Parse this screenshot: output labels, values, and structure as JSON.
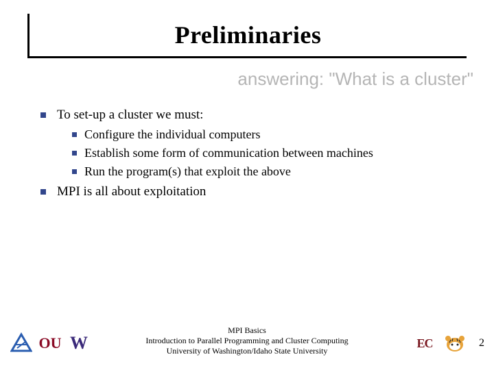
{
  "title": "Preliminaries",
  "subtitle": "answering: \"What is a cluster\"",
  "bullets": {
    "item0": "To set-up a cluster we must:",
    "sub0": "Configure the individual computers",
    "sub1": "Establish some form of communication between machines",
    "sub2": "Run the program(s) that exploit the above",
    "item1": "MPI is all about exploitation"
  },
  "footer": {
    "line0": "MPI Basics",
    "line1": "Introduction to Parallel Programming and Cluster Computing",
    "line2": "University of Washington/Idaho State University"
  },
  "page": "2",
  "logos": {
    "triangle": "triangle-logo",
    "ou": "OU",
    "w": "W",
    "ec": "EC",
    "tiger": "tiger-logo"
  }
}
